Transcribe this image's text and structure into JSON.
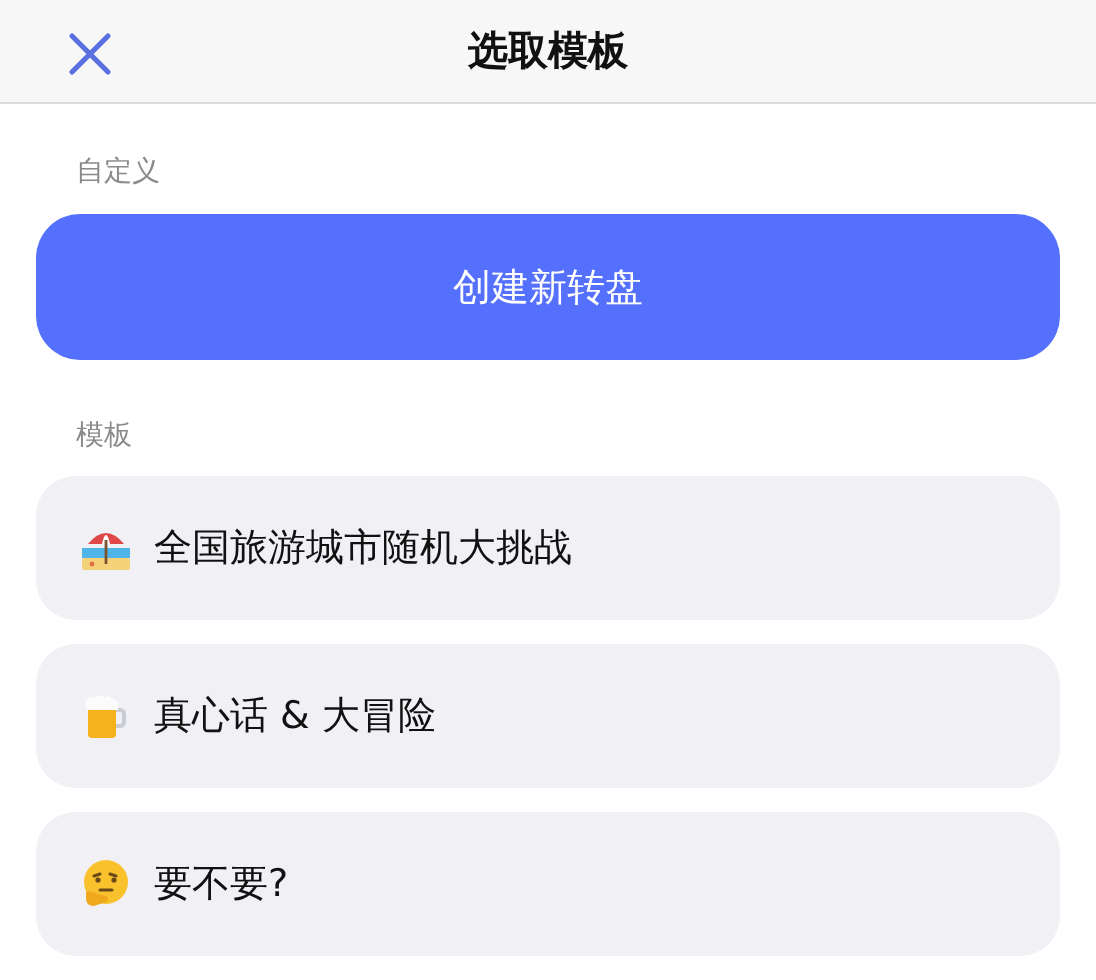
{
  "header": {
    "title": "选取模板"
  },
  "custom_section": {
    "label": "自定义",
    "button": "创建新转盘"
  },
  "template_section": {
    "label": "模板",
    "items": [
      {
        "kind": "beach",
        "label": "全国旅游城市随机大挑战"
      },
      {
        "kind": "beer",
        "label": "真心话 & 大冒险"
      },
      {
        "kind": "thinking",
        "label": "要不要?"
      }
    ]
  }
}
